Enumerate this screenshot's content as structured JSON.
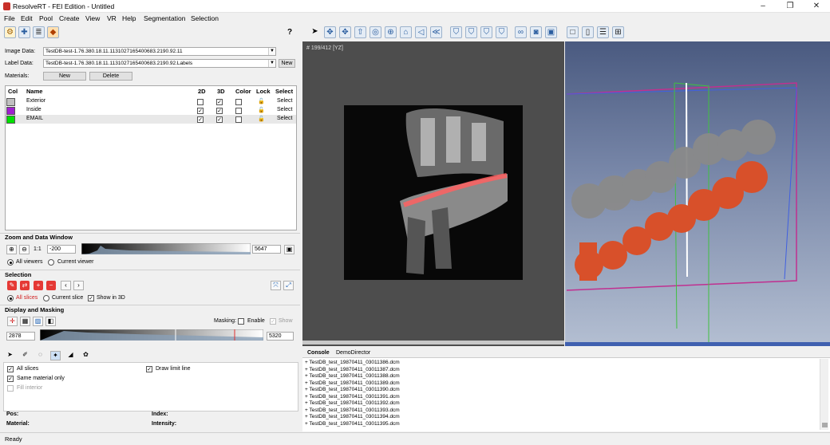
{
  "app": {
    "title": "ResolveRT - FEI Edition - Untitled"
  },
  "menu": [
    "File",
    "Edit",
    "Pool",
    "Create",
    "View",
    "VR",
    "Help",
    "Segmentation",
    "Selection"
  ],
  "left": {
    "image_data_label": "Image Data:",
    "image_data_value": "TestDB-test-1.76.380.18.11.1131027165400683.2190.92.11",
    "label_data_label": "Label Data:",
    "label_data_value": "TestDB-test-1.76.380.18.11.1131027165400683.2190.92.Labels",
    "new_button": "New",
    "materials_label": "Materials:",
    "materials_new": "New",
    "materials_delete": "Delete",
    "help_icon": "?",
    "table_headers": {
      "col": "Col",
      "name": "Name",
      "d2": "2D",
      "d3": "3D",
      "color": "Color",
      "lock": "Lock",
      "select": "Select"
    },
    "materials": [
      {
        "name": "Exterior",
        "color": "#c0c0c0",
        "d2": false,
        "d3": true,
        "colorcb": false,
        "select": "Select"
      },
      {
        "name": "Inside",
        "color": "#a020d0",
        "d2": true,
        "d3": true,
        "colorcb": false,
        "select": "Select"
      },
      {
        "name": "EMAIL",
        "color": "#00e000",
        "d2": true,
        "d3": true,
        "colorcb": false,
        "select": "Select"
      }
    ],
    "zoom_title": "Zoom and Data Window",
    "zoom_ratio": "1:1",
    "zoom_min": "-200",
    "zoom_max": "5647",
    "all_viewers": "All viewers",
    "current_viewer": "Current viewer",
    "selection_title": "Selection",
    "all_slices": "All slices",
    "current_slice": "Current slice",
    "show_in_3d": "Show in 3D",
    "display_title": "Display and Masking",
    "masking_label": "Masking:",
    "enable_label": "Enable",
    "show_label": "Show",
    "mask_min": "2878",
    "mask_max": "5320"
  },
  "slice": {
    "label": "# 199/412 [YZ]"
  },
  "tools": {
    "all_slices": "All slices",
    "same_material": "Same material only",
    "fill_interior": "Fill interior",
    "draw_limit": "Draw limit line",
    "pos": "Pos:",
    "index": "Index:",
    "material": "Material:",
    "intensity": "Intensity:"
  },
  "console": {
    "tabs": [
      "Console",
      "DemoDirector"
    ],
    "lines": [
      "+ TestDB_test_19870411_03011386.dcm",
      "+ TestDB_test_19870411_03011387.dcm",
      "+ TestDB_test_19870411_03011388.dcm",
      "+ TestDB_test_19870411_03011389.dcm",
      "+ TestDB_test_19870411_03011390.dcm",
      "+ TestDB_test_19870411_03011391.dcm",
      "+ TestDB_test_19870411_03011392.dcm",
      "+ TestDB_test_19870411_03011393.dcm",
      "+ TestDB_test_19870411_03011394.dcm",
      "+ TestDB_test_19870411_03011395.dcm"
    ]
  },
  "status": "Ready"
}
